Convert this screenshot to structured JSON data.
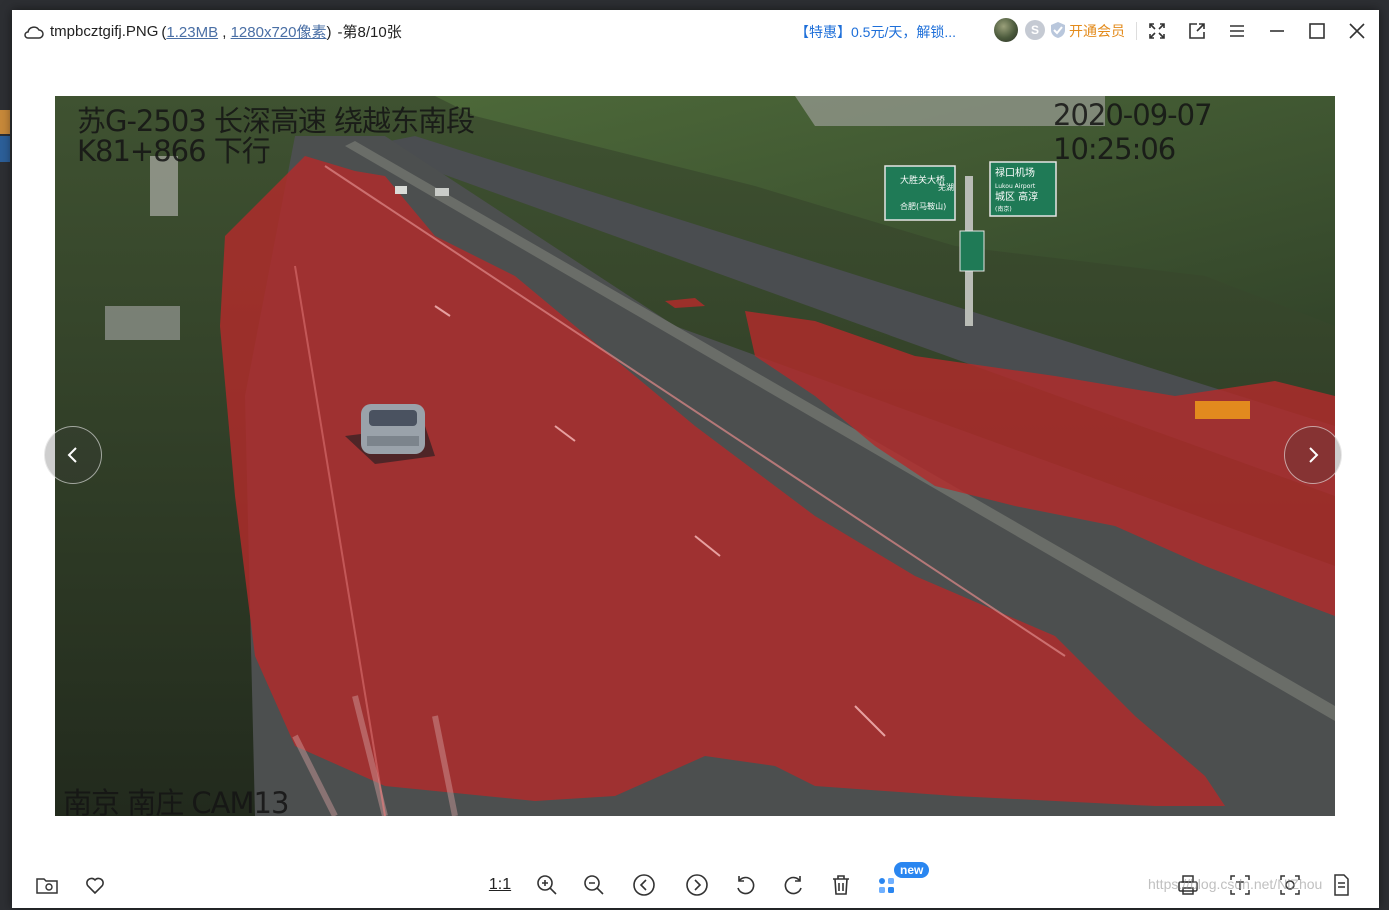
{
  "window": {
    "file_name": "tmpbcztgifj.PNG",
    "paren_open": "(",
    "file_size": "1.23MB",
    "comma": ",",
    "dimensions": "1280x720像素",
    "paren_close": ")",
    "position": "-第8/10张"
  },
  "promo": {
    "text": "【特惠】0.5元/天，解锁..."
  },
  "vip": {
    "s_label": "S",
    "open_label": "开通会员"
  },
  "image_overlay": {
    "line1": "苏G-2503 长深高速 绕越东南段",
    "line2": "K81+866 下行",
    "timestamp": "2020-09-07 10:25:06",
    "camera": "南京 南庄 CAM13",
    "sign_left_top": "大胜关大桥",
    "sign_left_bottom": "合肥(马鞍山)",
    "sign_left_side": "芜湖",
    "sign_right_line1": "禄口机场",
    "sign_right_line2": "Lukou Airport",
    "sign_right_line3": "城区 高淳",
    "sign_right_line4": "(南京)"
  },
  "bottombar": {
    "ratio_label": "1:1",
    "new_badge": "new"
  },
  "watermark": "https://blog.csdn.net/NiZhou"
}
